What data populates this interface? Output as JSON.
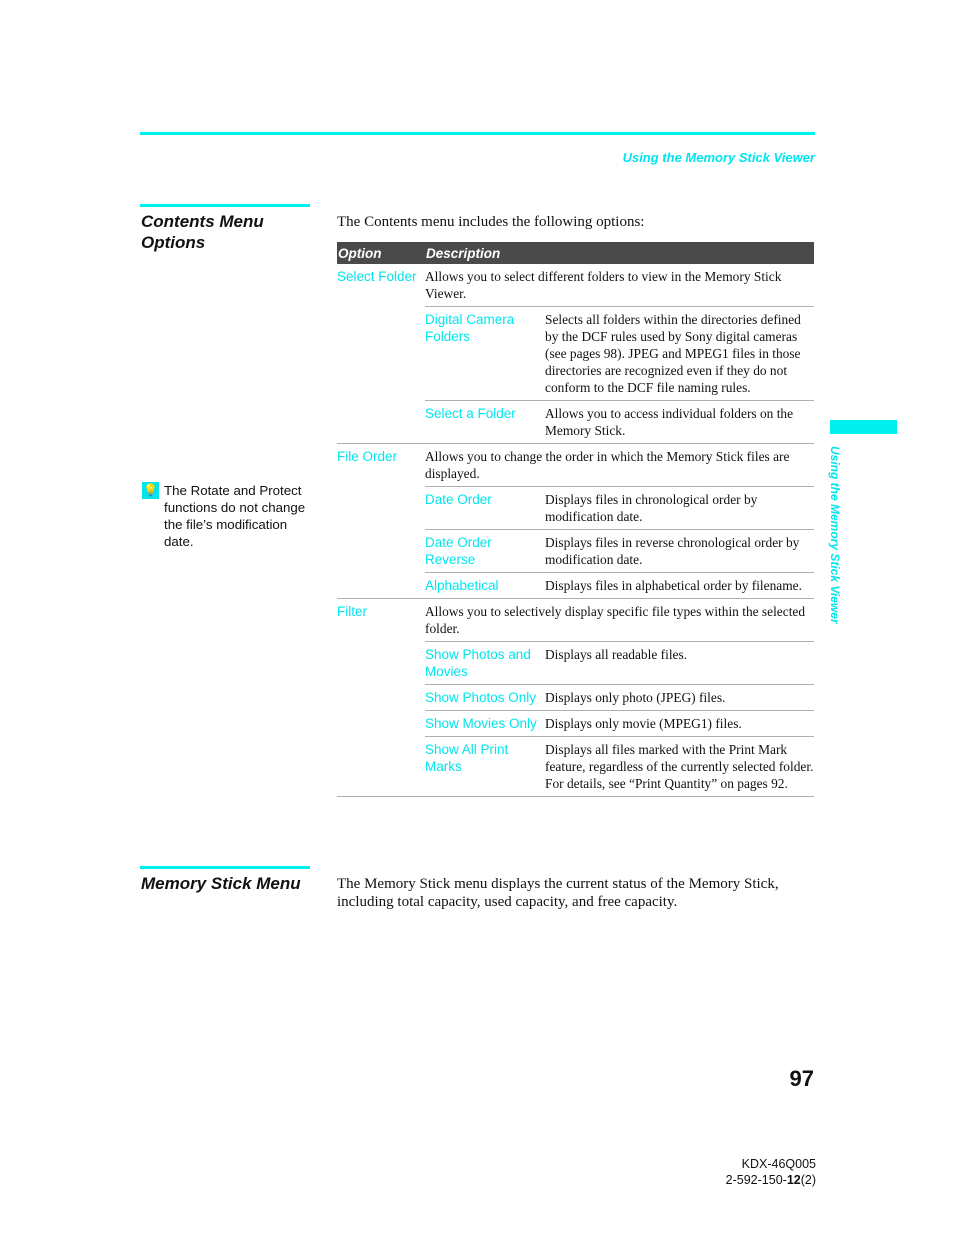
{
  "running_head": "Using the Memory Stick Viewer",
  "side_tab": "Using the Memory Stick Viewer",
  "contents_section": {
    "title_line1": "Contents Menu",
    "title_line2": "Options",
    "intro": "The Contents menu includes the following options:"
  },
  "tip": {
    "icon": "lightbulb-icon",
    "text": "The Rotate and Protect functions do not change the file’s modification date."
  },
  "table": {
    "headers": [
      "Option",
      "Description"
    ],
    "groups": [
      {
        "option": "Select Folder",
        "description": "Allows you to select different folders to view in the Memory Stick Viewer.",
        "subs": [
          {
            "label": "Digital Camera Folders",
            "description": "Selects all folders within the directories defined by the DCF rules used by Sony digital cameras (see pages 98). JPEG and MPEG1 files in those directories are recognized even if they do not conform to the DCF file naming rules."
          },
          {
            "label": "Select a Folder",
            "description": "Allows you to access individual folders on the Memory Stick."
          }
        ]
      },
      {
        "option": "File Order",
        "description": "Allows you to change the order in which the Memory Stick files are displayed.",
        "subs": [
          {
            "label": "Date Order",
            "description": "Displays files in chronological order by modification date."
          },
          {
            "label": "Date Order Reverse",
            "description": "Displays files in reverse chronological order by modification date."
          },
          {
            "label": "Alphabetical",
            "description": "Displays files in alphabetical order by filename."
          }
        ]
      },
      {
        "option": "Filter",
        "description": "Allows you to selectively display specific file types within the selected folder.",
        "subs": [
          {
            "label": "Show Photos and Movies",
            "description": "Displays all readable files."
          },
          {
            "label": "Show Photos Only",
            "description": "Displays only photo (JPEG) files."
          },
          {
            "label": "Show Movies Only",
            "description": "Displays only movie (MPEG1) files."
          },
          {
            "label": "Show All Print Marks",
            "description": "Displays all files marked with the Print Mark feature, regardless of the currently selected folder. For details, see “Print Quantity” on pages 92."
          }
        ]
      }
    ]
  },
  "memory_stick_section": {
    "title": "Memory Stick Menu",
    "text": "The Memory Stick menu displays the current status of the Memory Stick, including total capacity, used capacity, and free capacity."
  },
  "page_number": "97",
  "footer": {
    "model": "KDX-46Q005",
    "code_prefix": "2-592-150-",
    "code_bold": "12",
    "code_suffix": "(2)"
  },
  "colors": {
    "accent": "#00e5ee",
    "header_bar": "#4a4a4a"
  }
}
